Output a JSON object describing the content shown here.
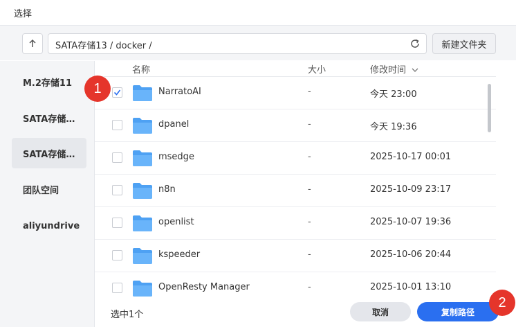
{
  "window": {
    "title": "选择"
  },
  "toolbar": {
    "path": "SATA存储13 / docker /",
    "new_folder_label": "新建文件夹"
  },
  "sidebar": {
    "items": [
      {
        "label": "M.2存储11",
        "active": false
      },
      {
        "label": "SATA存储…",
        "active": false
      },
      {
        "label": "SATA存储…",
        "active": true
      },
      {
        "label": "团队空间",
        "active": false
      },
      {
        "label": "aliyundrive",
        "active": false
      }
    ]
  },
  "list": {
    "columns": {
      "name": "名称",
      "size": "大小",
      "modified": "修改时间"
    },
    "rows": [
      {
        "name": "NarratoAI",
        "size": "-",
        "modified": "今天 23:00",
        "checked": true
      },
      {
        "name": "dpanel",
        "size": "-",
        "modified": "今天 19:36",
        "checked": false
      },
      {
        "name": "msedge",
        "size": "-",
        "modified": "2025-10-17 00:01",
        "checked": false
      },
      {
        "name": "n8n",
        "size": "-",
        "modified": "2025-10-09 23:17",
        "checked": false
      },
      {
        "name": "openlist",
        "size": "-",
        "modified": "2025-10-07 19:36",
        "checked": false
      },
      {
        "name": "kspeeder",
        "size": "-",
        "modified": "2025-10-06 20:44",
        "checked": false
      },
      {
        "name": "OpenResty Manager",
        "size": "-",
        "modified": "2025-10-01 13:10",
        "checked": false
      }
    ]
  },
  "footer": {
    "selected_text": "选中1个",
    "cancel_label": "取消",
    "copy_path_label": "复制路径"
  },
  "markers": {
    "first": "1",
    "second": "2"
  },
  "colors": {
    "accent": "#2a6ff0",
    "folder": "#4ea1f3",
    "marker": "#e5352b"
  }
}
